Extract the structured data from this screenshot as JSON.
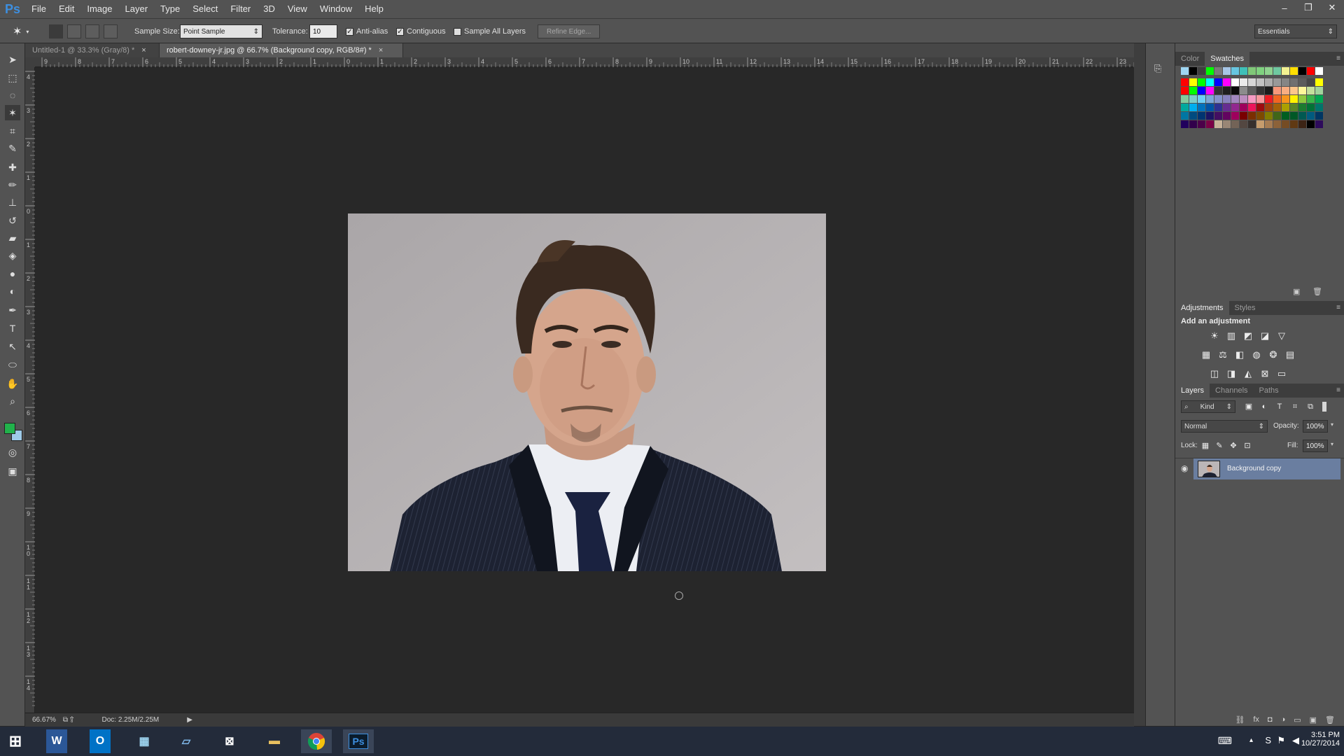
{
  "app": {
    "logo": "Ps",
    "menu": [
      "File",
      "Edit",
      "Image",
      "Layer",
      "Type",
      "Select",
      "Filter",
      "3D",
      "View",
      "Window",
      "Help"
    ],
    "window_controls": [
      "–",
      "❐",
      "✕"
    ]
  },
  "options": {
    "sample_size_label": "Sample Size:",
    "sample_size_value": "Point Sample",
    "tolerance_label": "Tolerance:",
    "tolerance_value": "10",
    "anti_alias_label": "Anti-alias",
    "anti_alias_checked": true,
    "contiguous_label": "Contiguous",
    "contiguous_checked": true,
    "sample_all_label": "Sample All Layers",
    "sample_all_checked": false,
    "refine_edge_label": "Refine Edge...",
    "workspace_value": "Essentials"
  },
  "tabs": [
    {
      "label": "Untitled-1 @ 33.3% (Gray/8) *",
      "close": "×",
      "active": false
    },
    {
      "label": "robert-downey-jr.jpg @ 66.7% (Background copy, RGB/8#) *",
      "close": "×",
      "active": true
    }
  ],
  "rulers": {
    "h_labels": [
      "9",
      "8",
      "7",
      "6",
      "5",
      "4",
      "3",
      "2",
      "1",
      "0",
      "1",
      "2",
      "3",
      "4",
      "5",
      "6",
      "7",
      "8",
      "9",
      "10",
      "11",
      "12",
      "13",
      "14",
      "15",
      "16",
      "17",
      "18",
      "19",
      "20",
      "21",
      "22",
      "23"
    ],
    "v_labels": [
      "4",
      "3",
      "2",
      "1",
      "0",
      "1",
      "2",
      "3",
      "4",
      "5",
      "6",
      "7",
      "8",
      "9",
      "1 0",
      "1 1",
      "1 2",
      "1 3",
      "1 4"
    ]
  },
  "status": {
    "zoom": "66.67%",
    "doc": "Doc: 2.25M/2.25M"
  },
  "panels": {
    "color_tab": "Color",
    "swatches_tab": "Swatches",
    "adjustments_tab": "Adjustments",
    "styles_tab": "Styles",
    "add_adjustment": "Add an adjustment",
    "layers_tab": "Layers",
    "channels_tab": "Channels",
    "paths_tab": "Paths",
    "kind_value": "Kind",
    "blend_mode": "Normal",
    "opacity_label": "Opacity:",
    "opacity_value": "100%",
    "lock_label": "Lock:",
    "fill_label": "Fill:",
    "fill_value": "100%",
    "layer_name": "Background copy"
  },
  "colors": {
    "foreground": "#21b24b",
    "background": "#9ecae8",
    "accent": "#3d8fe0"
  },
  "swatches": [
    [
      "#9fd6f2",
      "#000000",
      "#3f3f3f",
      "#00ff00",
      "#7a7a7a",
      "#a7c6e6",
      "#67c5e0",
      "#3fc0b8",
      "#80c878",
      "#7fd17f",
      "#8fd28f",
      "#6fc8a0",
      "#f1f191",
      "#ffde00",
      "#000000",
      "#ff0000",
      "#ffffff"
    ],
    [
      "#ff0000",
      "#ffff00",
      "#00ff00",
      "#00ffff",
      "#0000ff",
      "#ff00ff",
      "#ffffff",
      "#ebebeb",
      "#d6d6d6",
      "#c2c2c2",
      "#adadad",
      "#999999",
      "#858585",
      "#707070",
      "#5c5c5c",
      "#474747",
      "#ffff00"
    ],
    [
      "#ff0000",
      "#00ff00",
      "#0000ff",
      "#ff00ff",
      "#333333",
      "#1f1f1f",
      "#0a0a0a",
      "#8c8c8c",
      "#5e5e5e",
      "#343434",
      "#1c1c1c",
      "#f7977a",
      "#f9ad81",
      "#fdc68a",
      "#fff79a",
      "#c4df9b",
      "#a2d39c"
    ],
    [
      "#82ca9d",
      "#7bcdc8",
      "#6ecff6",
      "#7ea7d8",
      "#8493ca",
      "#8882be",
      "#a187be",
      "#bc8dbf",
      "#f49ac2",
      "#f6989d",
      "#ed1c24",
      "#f26522",
      "#f7941d",
      "#fff200",
      "#8dc73f",
      "#39b54a",
      "#00a651"
    ],
    [
      "#00a99d",
      "#00aeef",
      "#0072bc",
      "#0054a6",
      "#2e3192",
      "#662d91",
      "#92278f",
      "#9e005d",
      "#ed145b",
      "#9e0b0f",
      "#a0410d",
      "#a36209",
      "#aba000",
      "#598527",
      "#1a7b30",
      "#007236",
      "#00746b"
    ],
    [
      "#0076a3",
      "#004b80",
      "#003471",
      "#1b1464",
      "#440e62",
      "#630460",
      "#9e005d",
      "#790000",
      "#7b2e00",
      "#7d4900",
      "#827b00",
      "#406618",
      "#005e20",
      "#005826",
      "#005952",
      "#005b7f",
      "#003663"
    ],
    [
      "#21005d",
      "#32004b",
      "#4b0049",
      "#7b0046",
      "#c7b299",
      "#998675",
      "#736357",
      "#534741",
      "#37302d",
      "#c69c6d",
      "#a67c52",
      "#8c6239",
      "#754c24",
      "#603913",
      "#3c2415",
      "#000000",
      "#2d0b5b"
    ]
  ]
}
